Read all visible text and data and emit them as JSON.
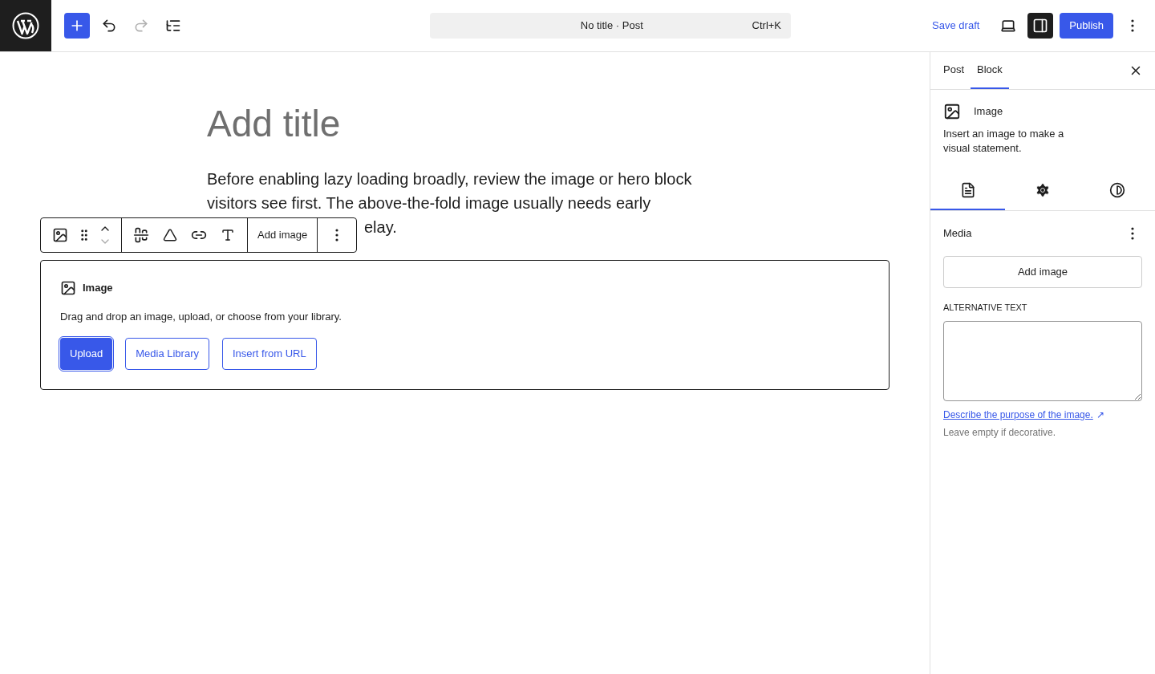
{
  "top_bar": {
    "document": {
      "title": "No title · Post",
      "shortcut": "Ctrl+K"
    },
    "redo_disabled": true,
    "save_draft": "Save draft",
    "settings_toggled": true,
    "publish": "Publish"
  },
  "editor": {
    "title_placeholder": "Add title",
    "paragraph_lines": [
      "Before enabling lazy loading broadly, review the image or hero block",
      "visitors see first. The above-the-fold image usually needs early"
    ],
    "paragraph_fragment": "elay.",
    "block_toolbar": {
      "add_image": "Add image"
    },
    "image_placeholder": {
      "title": "Image",
      "instructions": "Drag and drop an image, upload, or choose from your library.",
      "buttons": [
        {
          "label": "Upload",
          "kind": "primary"
        },
        {
          "label": "Media Library",
          "kind": "secondary"
        },
        {
          "label": "Insert from URL",
          "kind": "secondary"
        }
      ]
    }
  },
  "sidebar": {
    "tabs": [
      {
        "label": "Post",
        "selected": false
      },
      {
        "label": "Block",
        "selected": true
      }
    ],
    "block_card": {
      "title": "Image",
      "description": "Insert an image to make a visual statement."
    },
    "panel_tabs": [
      {
        "kind": "list",
        "selected": true
      },
      {
        "kind": "settings",
        "selected": false
      },
      {
        "kind": "styles",
        "selected": false
      }
    ],
    "media": {
      "title": "Media",
      "add_image": "Add image",
      "alt_label": "ALTERNATIVE TEXT",
      "alt_link": "Describe the purpose of the image.",
      "alt_link_mark": "↗",
      "alt_help": "Leave empty if decorative."
    }
  }
}
